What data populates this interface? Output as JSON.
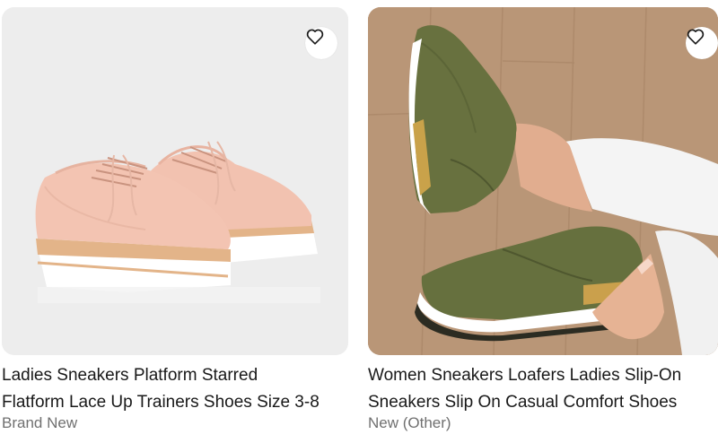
{
  "listings": [
    {
      "title_line1": "Ladies Sneakers Platform Starred",
      "title_line2": "Flatform Lace Up Trainers Shoes Size 3-8",
      "condition": "Brand New",
      "image_icon": "pink-platform-oxford-shoes-image",
      "watch_icon": "heart-icon"
    },
    {
      "title_line1": "Women Sneakers Loafers Ladies Slip-On",
      "title_line2": "Sneakers Slip On Casual Comfort Shoes",
      "condition": "New (Other)",
      "image_icon": "olive-slip-on-sneakers-image",
      "watch_icon": "heart-icon"
    }
  ],
  "colors": {
    "text": "#191919",
    "secondary_text": "#707070",
    "image_background": "#ededed",
    "floor_wood": "#b79377",
    "sneaker_olive": "#66703e"
  }
}
